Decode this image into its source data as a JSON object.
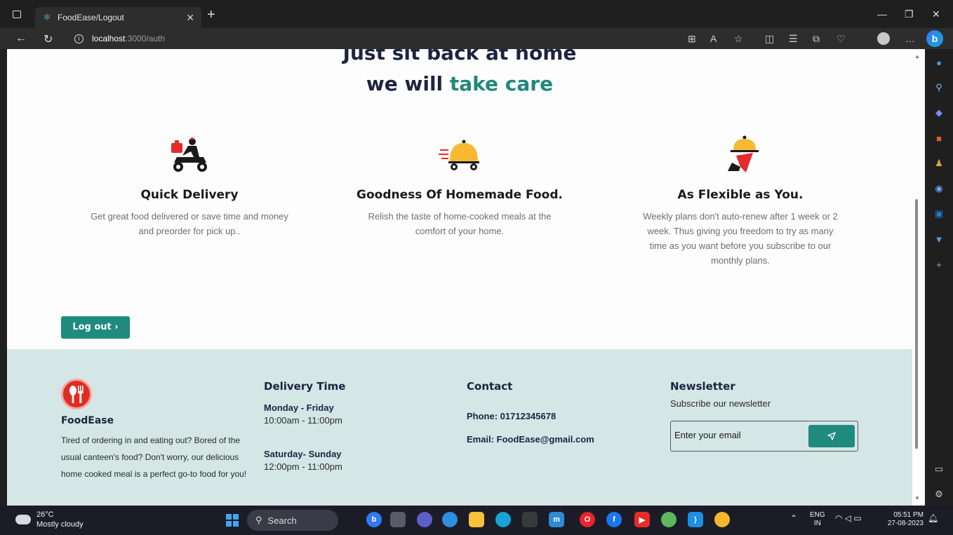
{
  "browser": {
    "tab_title": "FoodEase/Logout",
    "url_host": "localhost",
    "url_path": ":3000/auth"
  },
  "hero": {
    "line1": "Just sit back at home",
    "line2_prefix": "we will ",
    "line2_accent": "take care"
  },
  "features": [
    {
      "icon": "delivery-scooter-icon",
      "title": "Quick Delivery",
      "text": "Get great food delivered or save time and money and preorder for pick up.."
    },
    {
      "icon": "food-cloche-cart-icon",
      "title": "Goodness Of Homemade Food.",
      "text": "Relish the taste of home-cooked meals at the comfort of your home."
    },
    {
      "icon": "serving-hand-icon",
      "title": "As Flexible as You.",
      "text": "Weekly plans don't auto-renew after 1 week or 2 week. Thus giving you freedom to try as many time as you want before you subscribe to our monthly plans."
    }
  ],
  "logout_label": "Log out ›",
  "footer": {
    "brand": "FoodEase",
    "about": "Tired of ordering in and eating out? Bored of the usual canteen's food? Don't worry, our delicious home cooked meal is a perfect go-to food for you!",
    "delivery": {
      "heading": "Delivery Time",
      "weekday_label": "Monday - Friday",
      "weekday_hours": "10:00am - 11:00pm",
      "weekend_label": "Saturday- Sunday",
      "weekend_hours": "12:00pm - 11:00pm"
    },
    "contact": {
      "heading": "Contact",
      "phone": "Phone: 01712345678",
      "email": "Email: FoodEase@gmail.com"
    },
    "newsletter": {
      "heading": "Newsletter",
      "subtitle": "Subscribe our newsletter",
      "input_value": "Enter your email"
    }
  },
  "taskbar": {
    "temperature": "26°C",
    "weather": "Mostly cloudy",
    "search_label": "Search",
    "lang_top": "ENG",
    "lang_bottom": "IN",
    "time": "05:51 PM",
    "date": "27-08-2023"
  },
  "colors": {
    "accent": "#1f8a7e",
    "footer_bg": "#d4e6e5",
    "heading": "#1e2340"
  }
}
